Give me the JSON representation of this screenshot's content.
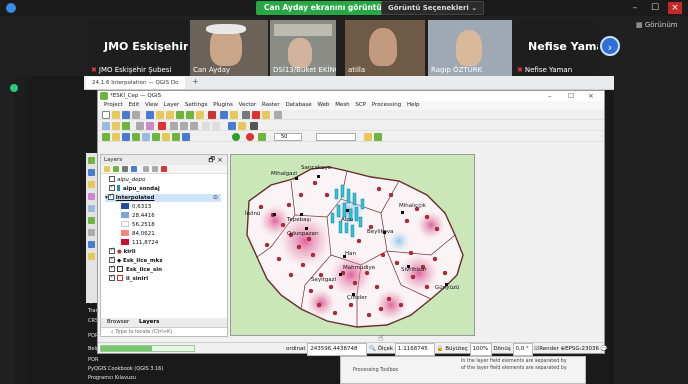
{
  "meeting": {
    "screen_share_banner": "Can Ayday ekranını görüntülüyorsunuz",
    "view_options": "Görüntü Seçenekleri",
    "right_panel_label": "Görünüm",
    "participants": [
      {
        "name": "JMO Eskişehir Şubesi",
        "big_label": "JMO Eskişehir Ş...",
        "muted": true
      },
      {
        "name": "Can Ayday",
        "muted": false
      },
      {
        "name": "DSİ13/Buket EKİNCİ",
        "muted": false
      },
      {
        "name": "atilla",
        "muted": false
      },
      {
        "name": "Ragıp ÖZTÜRK",
        "muted": false
      },
      {
        "name": "Nefise Yaman",
        "big_label": "Nefise Yaman",
        "muted": true
      }
    ]
  },
  "browser": {
    "tab_title": "24.1.6 Interpolation — QGIS Do",
    "new_tab": "+"
  },
  "qgis": {
    "window_title": "*ESKİ_Cep — QGIS",
    "menu": [
      "Project",
      "Edit",
      "View",
      "Layer",
      "Settings",
      "Plugins",
      "Vector",
      "Raster",
      "Database",
      "Web",
      "Mesh",
      "SCP",
      "Processing",
      "Help"
    ],
    "toolbar_field": "50",
    "layers_panel": {
      "title": "Layers",
      "layers": [
        {
          "name": "alpu_depo",
          "checked": false,
          "bold": false,
          "italic": true
        },
        {
          "name": "alpu_sondaj",
          "checked": true,
          "bold": true
        },
        {
          "name": "Interpolated",
          "checked": true,
          "bold": true,
          "selected": true
        },
        {
          "name": "0,6313",
          "legend": true,
          "color": "#1f4e9c"
        },
        {
          "name": "28,4416",
          "legend": true,
          "color": "#79a8d6"
        },
        {
          "name": "56,2518",
          "legend": true,
          "color": "#ffffff"
        },
        {
          "name": "84,0621",
          "legend": true,
          "color": "#f08a7a"
        },
        {
          "name": "111,8724",
          "legend": true,
          "color": "#c8102e"
        },
        {
          "name": "kirli",
          "checked": true,
          "bold": true
        },
        {
          "name": "Esk_ilce_mkz",
          "checked": true,
          "bold": true
        },
        {
          "name": "Esk_ilce_sin",
          "checked": true,
          "bold": true
        },
        {
          "name": "il_siniri",
          "checked": true,
          "bold": true
        }
      ],
      "tabs": [
        "Browser",
        "Layers"
      ],
      "locator_placeholder": "Type to locate (Ctrl+K)"
    },
    "map_labels": [
      "Mihalgazi",
      "Sarıcakaya",
      "İnönü",
      "Tepebaşı",
      "Odunpazarı",
      "Alpu",
      "Mihalıççık",
      "Beylikova",
      "Han",
      "Mahmudiye",
      "Seyitgazi",
      "Çifteler",
      "Sivrihisar",
      "Günyüzü"
    ],
    "status": {
      "coordinate_label": "ordinat",
      "coordinate": "243596,4438748",
      "scale_label": "Ölçek",
      "scale": "1:1168745",
      "magnifier_label": "Büyüteç",
      "magnifier": "100%",
      "rotation_label": "Dönüş",
      "rotation": "0,0 °",
      "render": "Render",
      "crs": "EPSG:23036",
      "progress": 0.55
    }
  },
  "background": {
    "left_items": [
      "QGIS",
      "Tran",
      "CRS",
      "POR",
      "Belg",
      "POR",
      "PyQGIS Cookbook (QGIS 3.16)",
      "Programcı Kılavuzu"
    ],
    "bottom_panel": [
      "Processing Toolbox",
      "In the layer field elements are separated by",
      "of the layer field elements are separated by"
    ]
  }
}
